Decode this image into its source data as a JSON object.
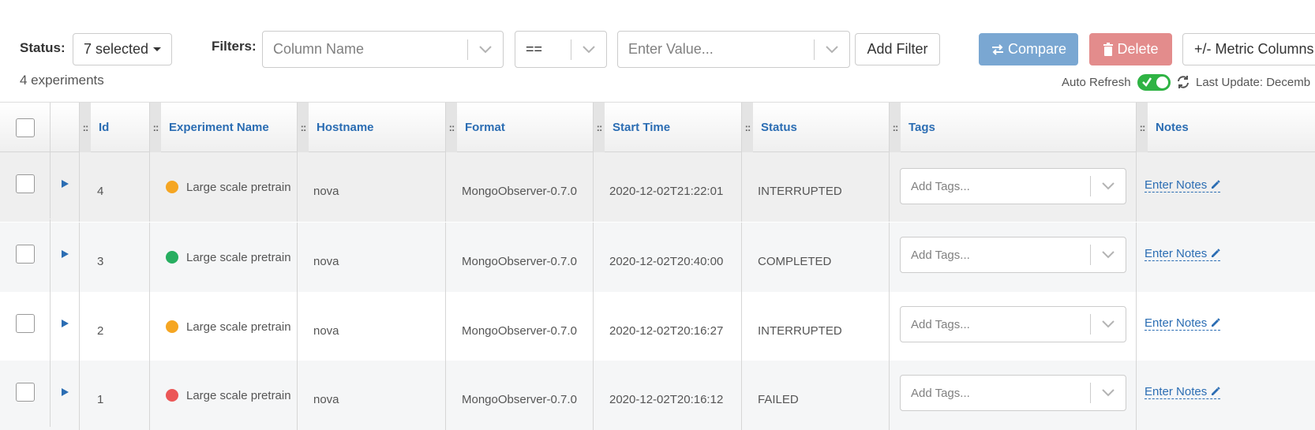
{
  "toolbar": {
    "status_label": "Status:",
    "status_value": "7 selected",
    "filters_label": "Filters:",
    "column_name_placeholder": "Column Name",
    "operator_value": "==",
    "value_placeholder": "Enter Value...",
    "add_filter_label": "Add Filter",
    "compare_label": "Compare",
    "delete_label": "Delete",
    "metric_columns_label": "+/- Metric Columns",
    "experiment_count": "4 experiments",
    "auto_refresh_label": "Auto Refresh",
    "last_update_label": "Last Update: Decemb",
    "colors": {
      "compare_bg": "#7aa7d2",
      "delete_bg": "#e38c8c",
      "toggle_on": "#2fb344",
      "link": "#2b6db3"
    }
  },
  "table": {
    "columns": [
      "Id",
      "Experiment Name",
      "Hostname",
      "Format",
      "Start Time",
      "Status",
      "Tags",
      "Notes"
    ],
    "tags_placeholder": "Add Tags...",
    "notes_label": "Enter Notes",
    "rows": [
      {
        "id": "4",
        "name": "Large scale pretrain",
        "hostname": "nova",
        "format": "MongoObserver-0.7.0",
        "start_time": "2020-12-02T21:22:01",
        "status": "INTERRUPTED",
        "status_color": "#f5a623"
      },
      {
        "id": "3",
        "name": "Large scale pretrain",
        "hostname": "nova",
        "format": "MongoObserver-0.7.0",
        "start_time": "2020-12-02T20:40:00",
        "status": "COMPLETED",
        "status_color": "#27ae60"
      },
      {
        "id": "2",
        "name": "Large scale pretrain",
        "hostname": "nova",
        "format": "MongoObserver-0.7.0",
        "start_time": "2020-12-02T20:16:27",
        "status": "INTERRUPTED",
        "status_color": "#f5a623"
      },
      {
        "id": "1",
        "name": "Large scale pretrain",
        "hostname": "nova",
        "format": "MongoObserver-0.7.0",
        "start_time": "2020-12-02T20:16:12",
        "status": "FAILED",
        "status_color": "#eb5757"
      }
    ]
  }
}
